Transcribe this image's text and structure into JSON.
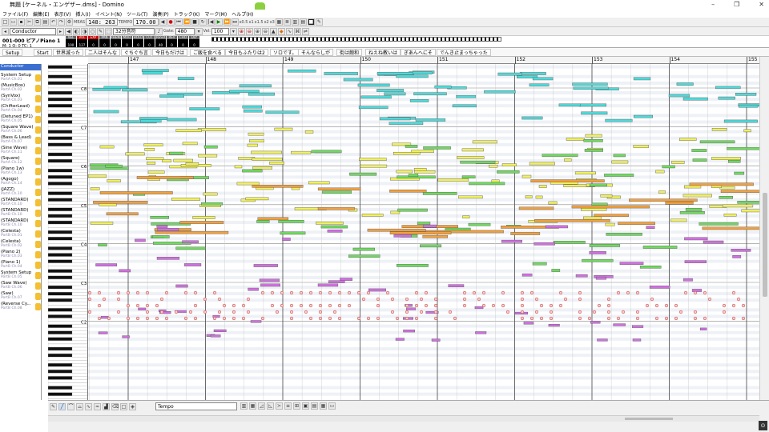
{
  "window": {
    "title": "無題 [ケーネル・エンゲザー.dms] - Domino",
    "controls": [
      "–",
      "❐",
      "✕"
    ]
  },
  "menu": [
    "ファイル(F)",
    "編集(E)",
    "表示(V)",
    "挿入(I)",
    "イベント(N)",
    "ツール(T)",
    "演奏(P)",
    "トラック(K)",
    "マーク(M)",
    "ヘルプ(H)"
  ],
  "toolbar1": {
    "meas_label": "MEAS",
    "meas_value": "148: 263",
    "tempo_label": "TEMPO",
    "tempo_value": "170.00",
    "speed_labels": [
      "x0.5",
      "x1",
      "x1.5",
      "x2",
      "x3"
    ]
  },
  "toolbar2": {
    "conductor_select": "Conductor",
    "snap_select": "32分音符",
    "gate_label": "Gate:",
    "gate_value": "480",
    "vel_label": "Vel:",
    "vel_value": "100"
  },
  "track_status": {
    "name": "001-000 ピアノPiano 1",
    "sub": "M: 1  O: 0  TC: 1",
    "meters": [
      {
        "label": "VEL",
        "value": "100",
        "alert": false
      },
      {
        "label": "VOL",
        "value": "127",
        "alert": true
      },
      {
        "label": "EXP",
        "value": "0",
        "alert": true
      },
      {
        "label": "PAN",
        "value": "0",
        "alert": false
      },
      {
        "label": "P.BEND",
        "value": "0",
        "alert": false
      },
      {
        "label": "MOD",
        "value": "0",
        "alert": false
      },
      {
        "label": "HOLD",
        "value": "0",
        "alert": false
      },
      {
        "label": "CUT",
        "value": "0",
        "alert": false
      },
      {
        "label": "RESO",
        "value": "40",
        "alert": false
      },
      {
        "label": "REV",
        "value": "0",
        "alert": false
      },
      {
        "label": "CHO",
        "value": "0",
        "alert": false
      },
      {
        "label": "DLY",
        "value": "0",
        "alert": false
      }
    ]
  },
  "markers": [
    "Setup",
    "Start",
    "世界滅った",
    "二人はそんな",
    "ぐちぐち言",
    "今日もだけは",
    "ご飯を食べる",
    "今日もふたりは2",
    "ソロです。",
    "そんならしが",
    "街は飽和",
    "ねえね教いは",
    "ぎあんへにそ",
    "でんき止まっちゃった"
  ],
  "ruler": {
    "bars": [
      "147",
      "148",
      "149",
      "150",
      "151",
      "152",
      "153",
      "154",
      "155"
    ]
  },
  "octaves": [
    "C8",
    "C7",
    "C6",
    "C5",
    "C4",
    "C3",
    "C2"
  ],
  "tracks": [
    {
      "name": "Conductor",
      "port": ""
    },
    {
      "name": "System Setup",
      "port": "PortA Ch.01"
    },
    {
      "name": "(MusicBox)",
      "port": "PortA Ch.02"
    },
    {
      "name": "(SynVox)",
      "port": "PortA Ch.03"
    },
    {
      "name": "(ChifterLead)",
      "port": "PortA Ch.04"
    },
    {
      "name": "(Detuned EP1)",
      "port": "PortA Ch.05"
    },
    {
      "name": "(Square Wave)",
      "port": "PortA Ch.06"
    },
    {
      "name": "(Bass & Lead)",
      "port": "PortA Ch.07"
    },
    {
      "name": "(Sine Wave)",
      "port": "PortA Ch.11"
    },
    {
      "name": "(Square)",
      "port": "PortA Ch.12"
    },
    {
      "name": "(Piano 1w)",
      "port": "PortA Ch.13"
    },
    {
      "name": "(Agogo)",
      "port": "PortA Ch.14"
    },
    {
      "name": "(JAZZ)",
      "port": "PortA Ch.10"
    },
    {
      "name": "(STANDARD)",
      "port": "PortA Ch.10"
    },
    {
      "name": "(STANDARD)",
      "port": "PortB Ch.10"
    },
    {
      "name": "(STANDARD)",
      "port": "PortB Ch.10"
    },
    {
      "name": "(Celesta)",
      "port": "PortB Ch.01"
    },
    {
      "name": "(Celesta)",
      "port": "PortB Ch.02"
    },
    {
      "name": "(Piano 2)",
      "port": "PortB Ch.03"
    },
    {
      "name": "(Piano 1)",
      "port": "PortB Ch.04"
    },
    {
      "name": "System Setup",
      "port": "PortB Ch.05"
    },
    {
      "name": "(Saw Wave)",
      "port": "PortB Ch.06"
    },
    {
      "name": "(Saw)",
      "port": "PortB Ch.07"
    },
    {
      "name": "(Reverse Cy...",
      "port": "PortB Ch.08"
    }
  ],
  "bottom": {
    "event_select": "Tempo"
  },
  "colors": {
    "accent": "#3a6fd0",
    "cyan": "#50d8d8",
    "yellow": "#f0f060",
    "green": "#70d860",
    "orange": "#f0a040",
    "magenta": "#d070e0",
    "drum": "#d05050"
  }
}
